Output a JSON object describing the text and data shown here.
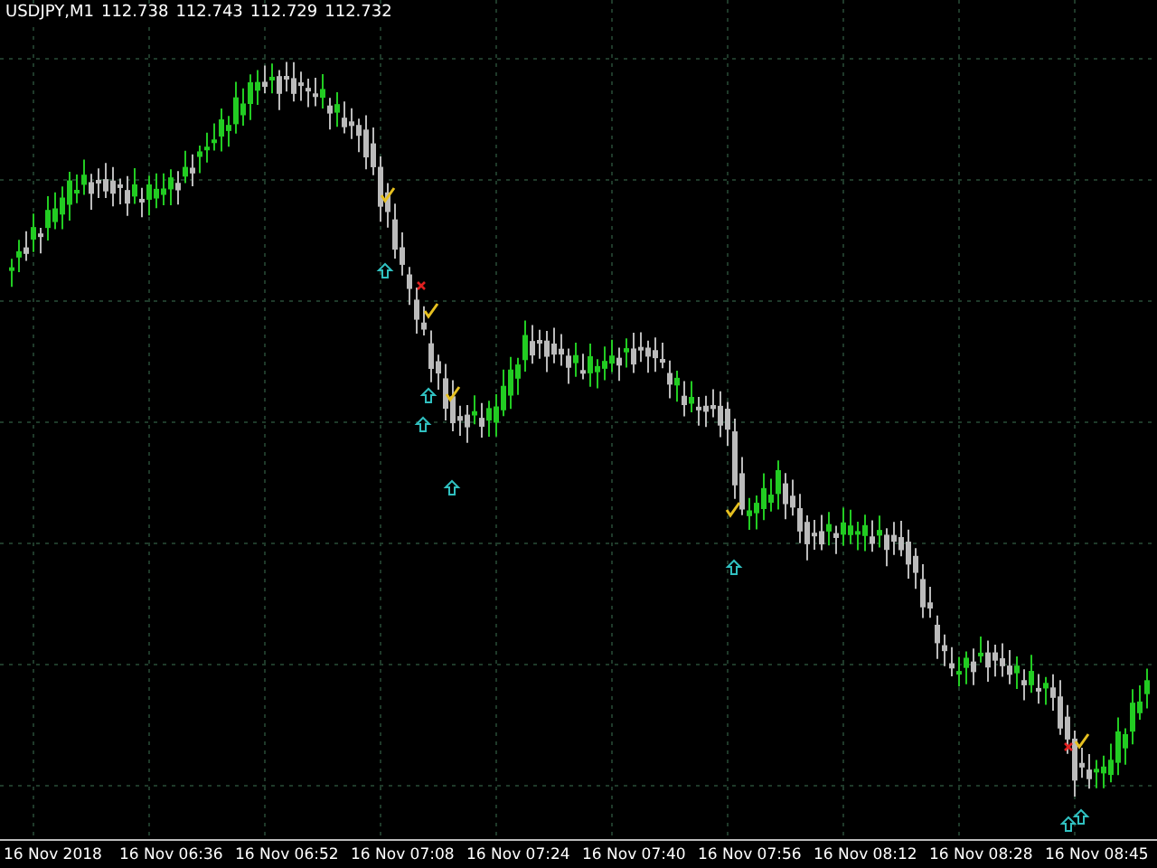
{
  "chart": {
    "symbol": "USDJPY,M1",
    "quote": [
      "112.738",
      "112.743",
      "112.729",
      "112.732"
    ],
    "time_axis": [
      "16 Nov 2018",
      "16 Nov 06:36",
      "16 Nov 06:52",
      "16 Nov 07:08",
      "16 Nov 07:24",
      "16 Nov 07:40",
      "16 Nov 07:56",
      "16 Nov 08:12",
      "16 Nov 08:28",
      "16 Nov 08:45"
    ]
  }
}
